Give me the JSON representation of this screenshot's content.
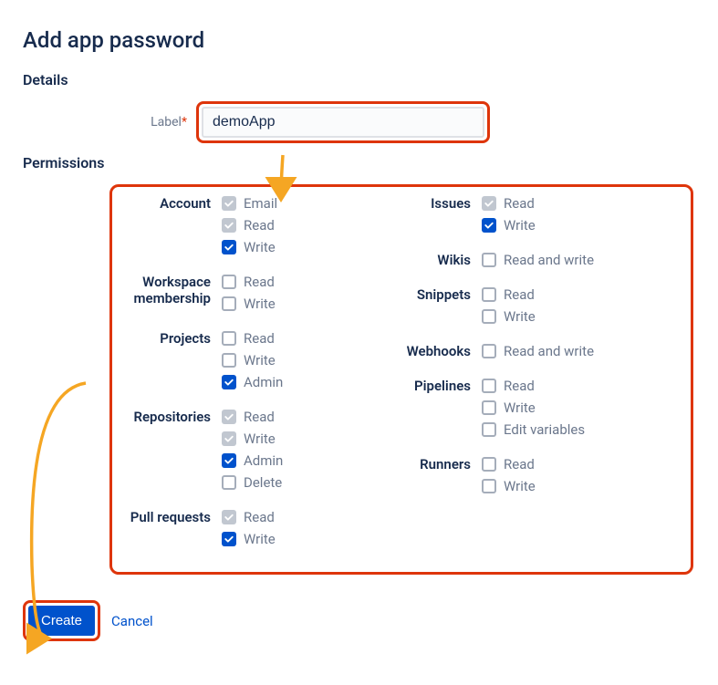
{
  "page_title": "Add app password",
  "details": {
    "heading": "Details",
    "label_label": "Label",
    "label_value": "demoApp"
  },
  "permissions": {
    "heading": "Permissions",
    "left": [
      {
        "name": "Account",
        "options": [
          {
            "label": "Email",
            "state": "disabled-checked"
          },
          {
            "label": "Read",
            "state": "disabled-checked"
          },
          {
            "label": "Write",
            "state": "checked"
          }
        ]
      },
      {
        "name": "Workspace membership",
        "options": [
          {
            "label": "Read",
            "state": "unchecked"
          },
          {
            "label": "Write",
            "state": "unchecked"
          }
        ]
      },
      {
        "name": "Projects",
        "options": [
          {
            "label": "Read",
            "state": "unchecked"
          },
          {
            "label": "Write",
            "state": "unchecked"
          },
          {
            "label": "Admin",
            "state": "checked"
          }
        ]
      },
      {
        "name": "Repositories",
        "options": [
          {
            "label": "Read",
            "state": "disabled-checked"
          },
          {
            "label": "Write",
            "state": "disabled-checked"
          },
          {
            "label": "Admin",
            "state": "checked"
          },
          {
            "label": "Delete",
            "state": "unchecked"
          }
        ]
      },
      {
        "name": "Pull requests",
        "options": [
          {
            "label": "Read",
            "state": "disabled-checked"
          },
          {
            "label": "Write",
            "state": "checked"
          }
        ]
      }
    ],
    "right": [
      {
        "name": "Issues",
        "options": [
          {
            "label": "Read",
            "state": "disabled-checked"
          },
          {
            "label": "Write",
            "state": "checked"
          }
        ]
      },
      {
        "name": "Wikis",
        "options": [
          {
            "label": "Read and write",
            "state": "unchecked"
          }
        ]
      },
      {
        "name": "Snippets",
        "options": [
          {
            "label": "Read",
            "state": "unchecked"
          },
          {
            "label": "Write",
            "state": "unchecked"
          }
        ]
      },
      {
        "name": "Webhooks",
        "options": [
          {
            "label": "Read and write",
            "state": "unchecked"
          }
        ]
      },
      {
        "name": "Pipelines",
        "options": [
          {
            "label": "Read",
            "state": "unchecked"
          },
          {
            "label": "Write",
            "state": "unchecked"
          },
          {
            "label": "Edit variables",
            "state": "unchecked"
          }
        ]
      },
      {
        "name": "Runners",
        "options": [
          {
            "label": "Read",
            "state": "unchecked"
          },
          {
            "label": "Write",
            "state": "unchecked"
          }
        ]
      }
    ]
  },
  "buttons": {
    "create": "Create",
    "cancel": "Cancel"
  }
}
